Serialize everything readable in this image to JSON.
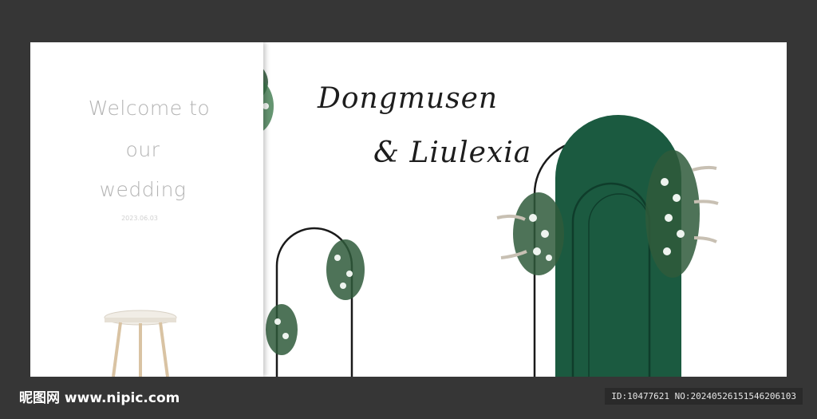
{
  "welcome": {
    "line1": "Welcome to",
    "line2": "our",
    "line3": "wedding",
    "date": "2023.06.03"
  },
  "couple": {
    "line1": "Dongmusen",
    "line2": "& Liulexia"
  },
  "watermark": {
    "site": "昵图网 www.nipic.com",
    "id": "ID:10477621 NO:20240526151546206103"
  },
  "colors": {
    "arch_green": "#1b5a40",
    "background": "#363636",
    "paper": "#ffffff"
  }
}
